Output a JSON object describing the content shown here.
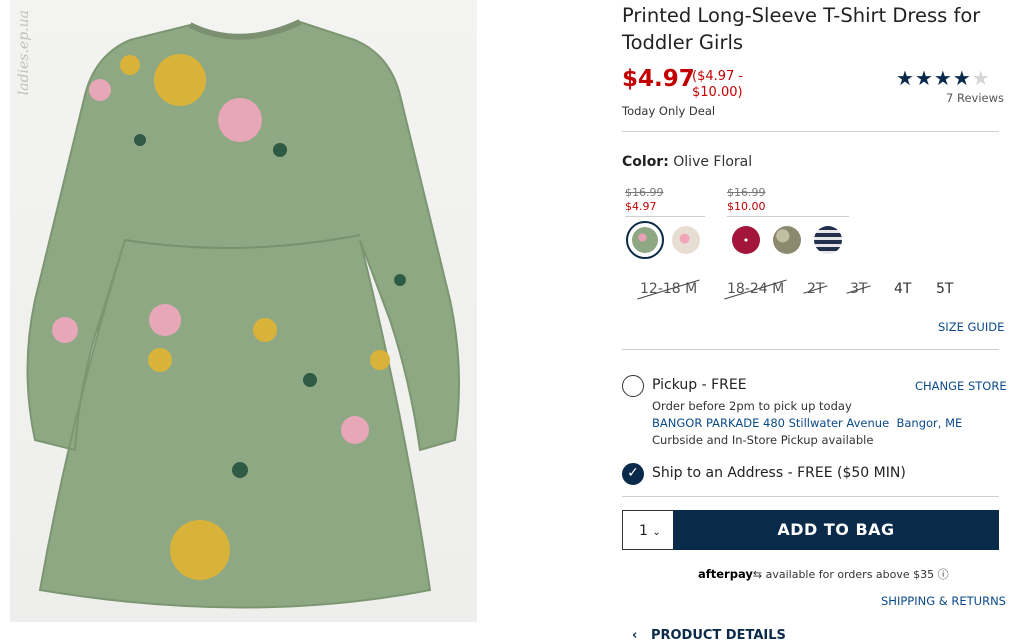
{
  "product": {
    "title": "Printed Long-Sleeve T-Shirt Dress for Toddler Girls",
    "price": "$4.97",
    "price_range": "($4.97 - $10.00)",
    "deal_label": "Today Only Deal",
    "rating": 4,
    "rating_max": 5,
    "reviews": "7 Reviews",
    "watermark": "ladies.ep.ua"
  },
  "color": {
    "label": "Color:",
    "value": "Olive Floral",
    "groups": [
      {
        "old_price": "$16.99",
        "new_price": "$4.97"
      },
      {
        "old_price": "$16.99",
        "new_price": "$10.00"
      }
    ],
    "swatches": [
      {
        "name": "olive-floral",
        "color": "#8fa884",
        "selected": true
      },
      {
        "name": "light-floral",
        "color": "#e9e0d8",
        "selected": false
      },
      {
        "name": "red-dot",
        "color": "#a3153a",
        "selected": false
      },
      {
        "name": "camo",
        "color": "#9c9a80",
        "selected": false
      },
      {
        "name": "navy-stripe",
        "color": "#23304d",
        "selected": false
      }
    ]
  },
  "sizes": [
    {
      "label": "12-18 M",
      "available": false
    },
    {
      "label": "18-24 M",
      "available": false
    },
    {
      "label": "2T",
      "available": false
    },
    {
      "label": "3T",
      "available": false
    },
    {
      "label": "4T",
      "available": true
    },
    {
      "label": "5T",
      "available": true
    }
  ],
  "size_guide": "SIZE GUIDE",
  "fulfillment": {
    "pickup_label": "Pickup - FREE",
    "change_store": "CHANGE STORE",
    "pickup_note": "Order before 2pm to pick up today",
    "store_name": "BANGOR PARKADE 480 Stillwater Avenue",
    "store_city": "Bangor, ME",
    "pickup_avail": "Curbside and In-Store Pickup available",
    "ship_label": "Ship to an Address - FREE ($50 MIN)"
  },
  "cart": {
    "quantity": "1",
    "add_label": "ADD TO BAG"
  },
  "afterpay": {
    "brand": "afterpay",
    "text": "available for orders above $35"
  },
  "shipping_returns": "SHIPPING & RETURNS",
  "details_label": "PRODUCT DETAILS",
  "colors": {
    "navy": "#0a2a4a",
    "sale_red": "#c30000",
    "link": "#0a4a8a"
  }
}
